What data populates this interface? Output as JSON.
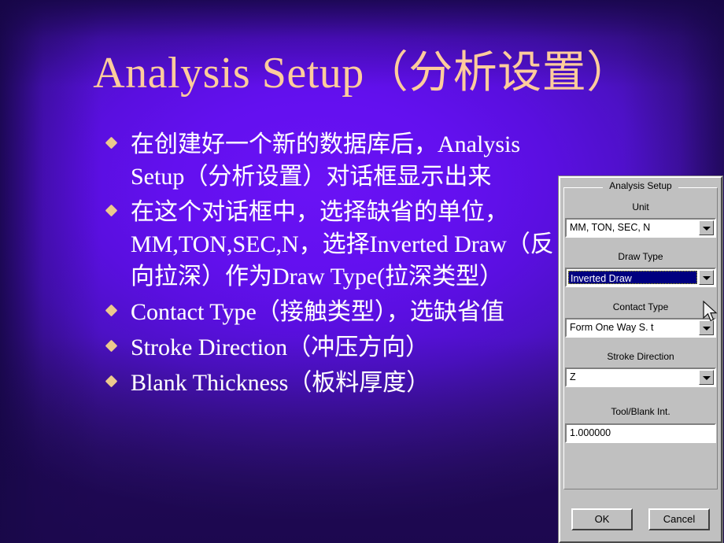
{
  "slide": {
    "title": "Analysis Setup（分析设置）",
    "title_color": "#ffcc9c",
    "body_color": "#ffffff",
    "bullet_marker_color": "#ecc98d",
    "background_center_color": "#6a12f5",
    "background_edge_color": "#23095c",
    "bullets": [
      {
        "text": "在创建好一个新的数据库后，Analysis Setup（分析设置）对话框显示出来"
      },
      {
        "text": "在这个对话框中，选择缺省的单位，MM,TON,SEC,N，选择Inverted Draw（反向拉深）作为Draw Type(拉深类型）"
      },
      {
        "text": "Contact Type（接触类型），选缺省值"
      },
      {
        "text": "Stroke Direction（冲压方向）"
      },
      {
        "text": "Blank Thickness（板料厚度）"
      }
    ]
  },
  "dialog": {
    "group_title": "Analysis Setup",
    "fields": [
      {
        "label": "Unit",
        "value": "MM, TON, SEC, N",
        "kind": "combo",
        "selected": false
      },
      {
        "label": "Draw Type",
        "value": "Inverted Draw",
        "kind": "combo",
        "selected": true
      },
      {
        "label": "Contact Type",
        "value": "Form One Way S. t",
        "kind": "combo",
        "selected": false
      },
      {
        "label": "Stroke Direction",
        "value": "Z",
        "kind": "combo",
        "selected": false
      },
      {
        "label": "Tool/Blank Int.",
        "value": "1.000000",
        "kind": "textbox",
        "selected": false
      }
    ],
    "buttons": {
      "ok": "OK",
      "cancel": "Cancel"
    },
    "highlight_color": "#000080",
    "face_color": "#c0c0c0"
  }
}
